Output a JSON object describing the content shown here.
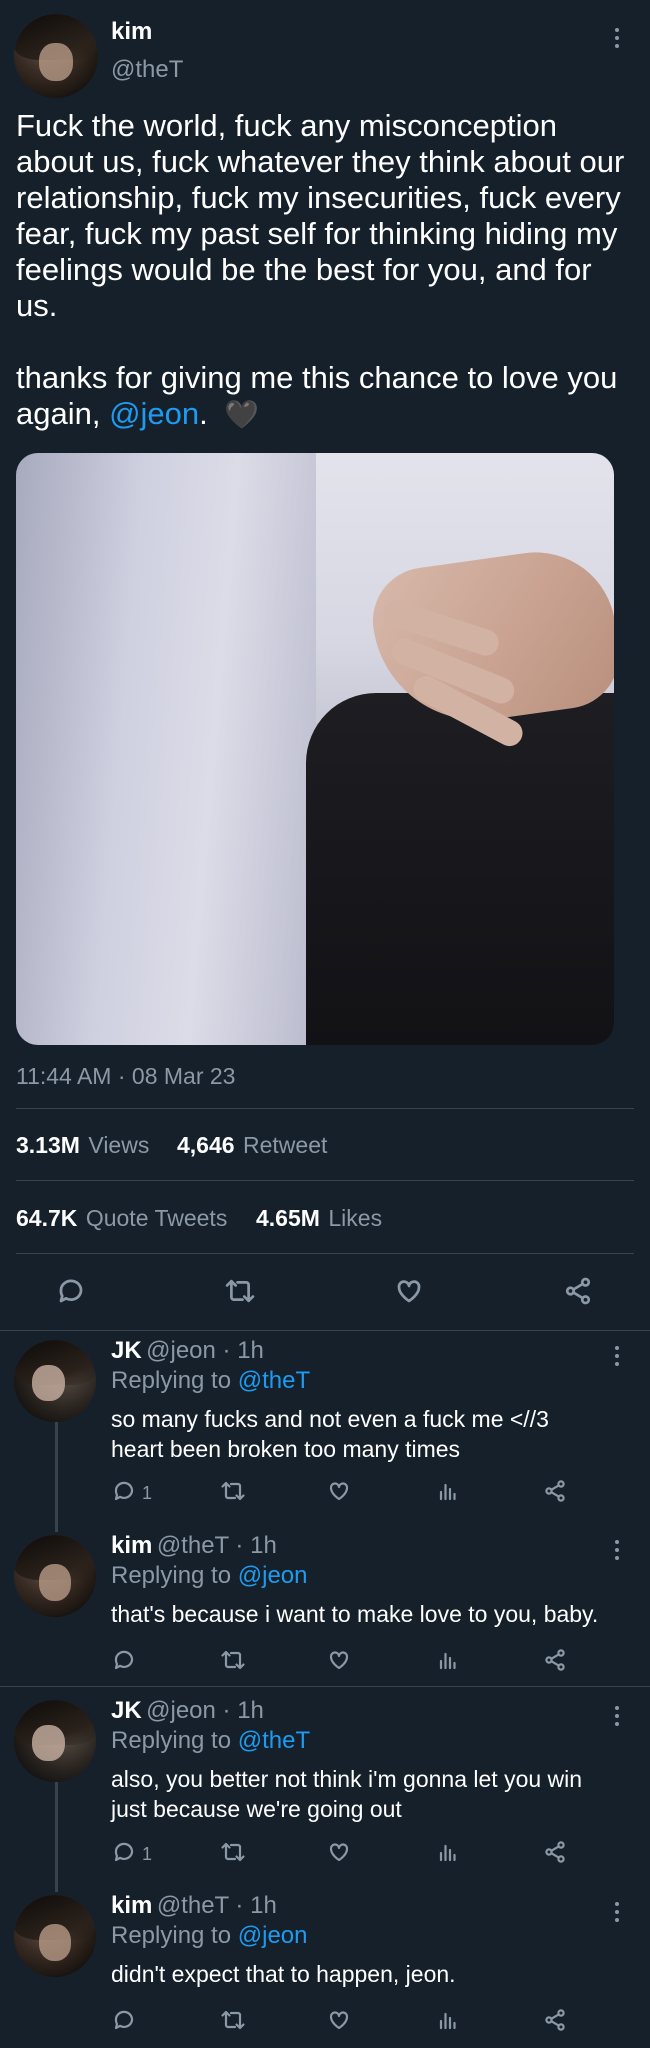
{
  "tweet": {
    "author_name": "kim",
    "author_handle": "@theT",
    "text_line1": "Fuck the world, fuck any misconception",
    "text_line2": "about us, fuck whatever they think about our",
    "text_line3": "relationship, fuck my insecurities, fuck every",
    "text_line4": "fear, fuck my past self for thinking hiding my",
    "text_line5": "feelings would be the best for you, and for",
    "text_line6": "us.",
    "text_line7": "thanks for giving me this chance to love you",
    "text_line8_prefix": "again, ",
    "text_line8_mention": "@jeon",
    "text_line8_suffix": ".",
    "emoji": "🖤",
    "timestamp": "11:44 AM · 08 Mar 23"
  },
  "stats": {
    "views_value": "3.13M",
    "views_label": "Views",
    "retweets_value": "4,646",
    "retweets_label": "Retweet",
    "quotes_value": "64.7K",
    "quotes_label": "Quote Tweets",
    "likes_value": "4.65M",
    "likes_label": "Likes"
  },
  "replies": [
    {
      "name": "JK",
      "meta": "@jeon · 1h",
      "replying_prefix": "Replying to ",
      "replying_to": "@theT",
      "line1": "so many fucks and not even a fuck me <//3",
      "line2": "heart been broken too many times",
      "reply_count": "1"
    },
    {
      "name": "kim",
      "meta": "@theT · 1h",
      "replying_prefix": "Replying to ",
      "replying_to": "@jeon",
      "line1": "that's because i want to make love to you, baby.",
      "reply_count": ""
    },
    {
      "name": "JK",
      "meta": "@jeon · 1h",
      "replying_prefix": "Replying to ",
      "replying_to": "@theT",
      "line1": "also, you better not think i'm gonna let you win",
      "line2": "just because we're going out",
      "reply_count": "1"
    },
    {
      "name": "kim",
      "meta": "@theT · 1h",
      "replying_prefix": "Replying to ",
      "replying_to": "@jeon",
      "line1": "didn't expect that to happen, jeon.",
      "reply_count": ""
    }
  ],
  "colors": {
    "background": "#15202b",
    "accent": "#1d9bf0",
    "muted": "#8b98a5",
    "divider": "#38444d"
  },
  "icons": [
    "more-icon",
    "reply-icon",
    "retweet-icon",
    "like-icon",
    "share-icon",
    "analytics-icon"
  ]
}
